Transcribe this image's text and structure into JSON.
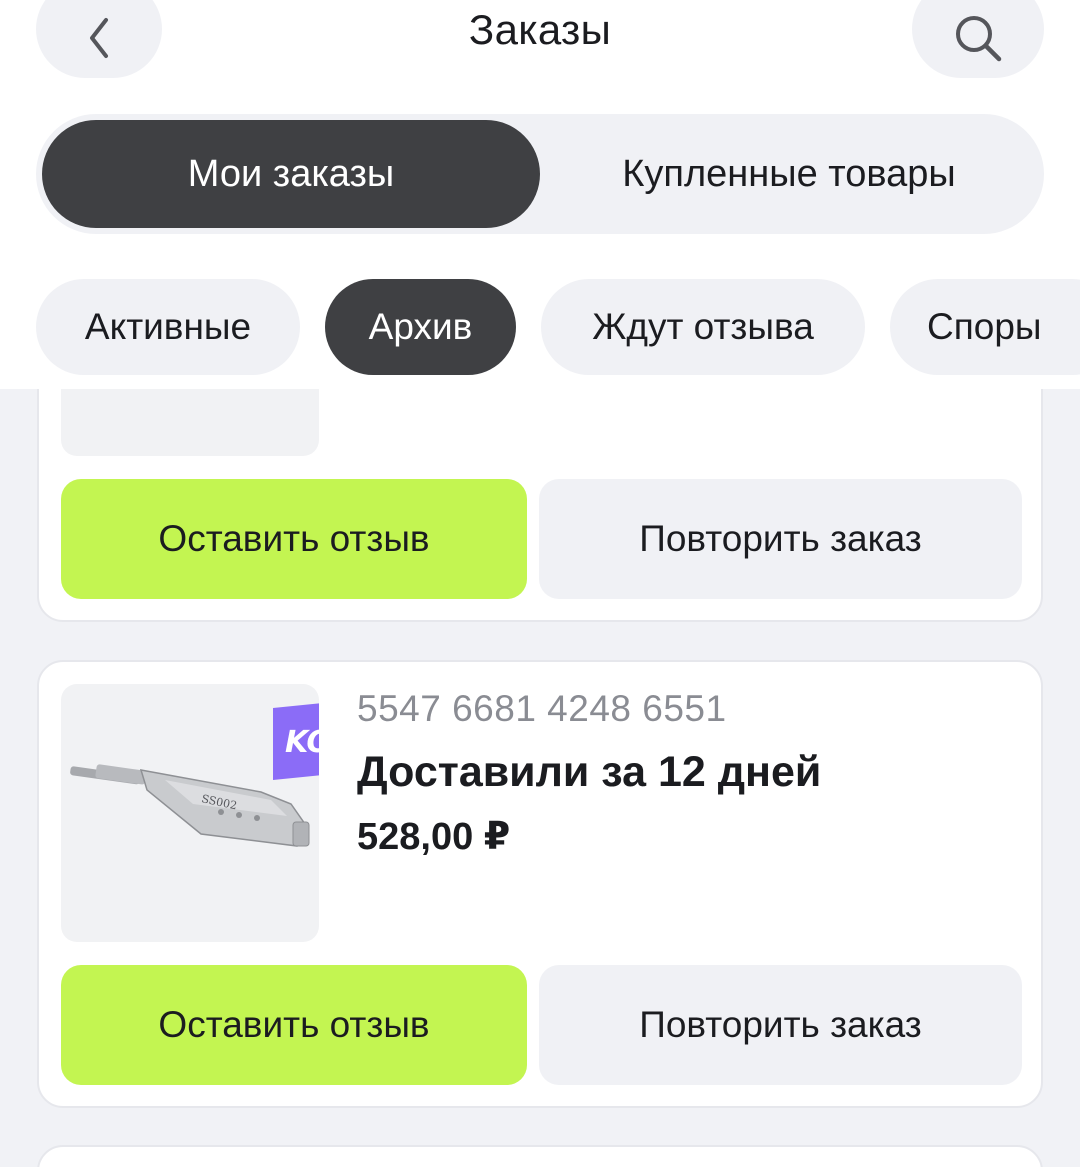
{
  "header": {
    "title": "Заказы",
    "back_icon": "chevron-left-icon",
    "search_icon": "search-icon"
  },
  "segments": {
    "mine": "Мои заказы",
    "bought": "Купленные товары",
    "selected": "mine"
  },
  "filters": {
    "active": "Активные",
    "archive": "Архив",
    "awaiting_review": "Ждут отзыва",
    "disputes": "Споры",
    "selected": "archive"
  },
  "orders": [
    {
      "review_button": "Оставить отзыв",
      "repeat_button": "Повторить заказ"
    },
    {
      "number": "5547 6681 4248 6551",
      "status": "Доставили за 12 дней",
      "price": "528,00 ₽",
      "badge": "KO!",
      "image_text": "SS002",
      "review_button": "Оставить отзыв",
      "repeat_button": "Повторить заказ"
    }
  ],
  "colors": {
    "accent_green": "#c3f551",
    "dark_pill": "#3f4043",
    "badge_purple": "#8b6cf7",
    "muted_text": "#8a8c93",
    "pill_bg": "#f0f1f5"
  }
}
